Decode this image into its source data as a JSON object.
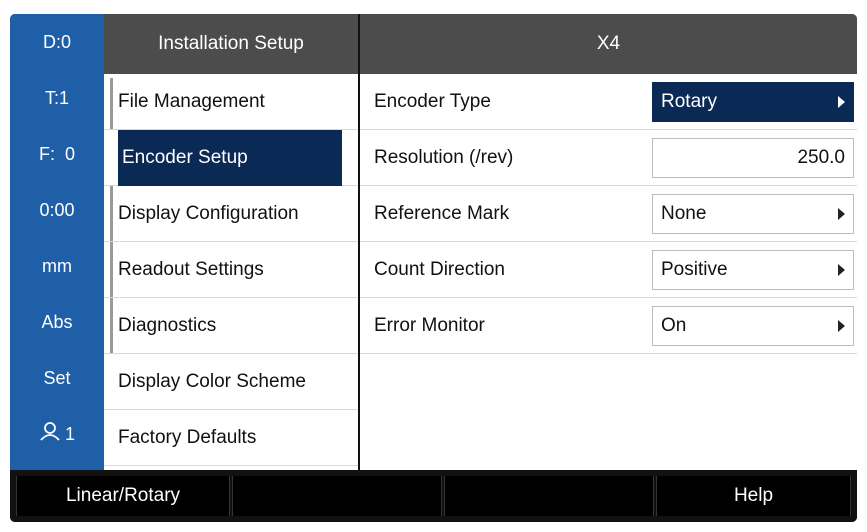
{
  "status_bar": {
    "items": [
      {
        "label": "D:0"
      },
      {
        "label": "T:1"
      },
      {
        "label": "F:  0"
      },
      {
        "label": "0:00"
      },
      {
        "label": "mm"
      },
      {
        "label": "Abs"
      },
      {
        "label": "Set"
      },
      {
        "label": "1",
        "icon": "user-icon"
      }
    ],
    "background": "#1f5fa8"
  },
  "menu": {
    "title": "Installation Setup",
    "items": [
      {
        "label": "File Management"
      },
      {
        "label": "Encoder Setup",
        "active": true
      },
      {
        "label": "Display Configuration"
      },
      {
        "label": "Readout Settings"
      },
      {
        "label": "Diagnostics"
      },
      {
        "label": "Display Color Scheme"
      },
      {
        "label": "Factory Defaults"
      }
    ]
  },
  "params": {
    "title": "X4",
    "rows": [
      {
        "label": "Encoder Type",
        "value": "Rotary",
        "selected": true
      },
      {
        "label": "Resolution (/rev)",
        "value": "250.0"
      },
      {
        "label": "Reference Mark",
        "value": "None"
      },
      {
        "label": "Count Direction",
        "value": "Positive"
      },
      {
        "label": "Error Monitor",
        "value": "On"
      }
    ]
  },
  "softkeys": [
    {
      "label": "Linear/Rotary"
    },
    {
      "label": ""
    },
    {
      "label": ""
    },
    {
      "label": "Help"
    }
  ],
  "colors": {
    "accent": "#0a2a55",
    "header": "#4c4c4c"
  }
}
